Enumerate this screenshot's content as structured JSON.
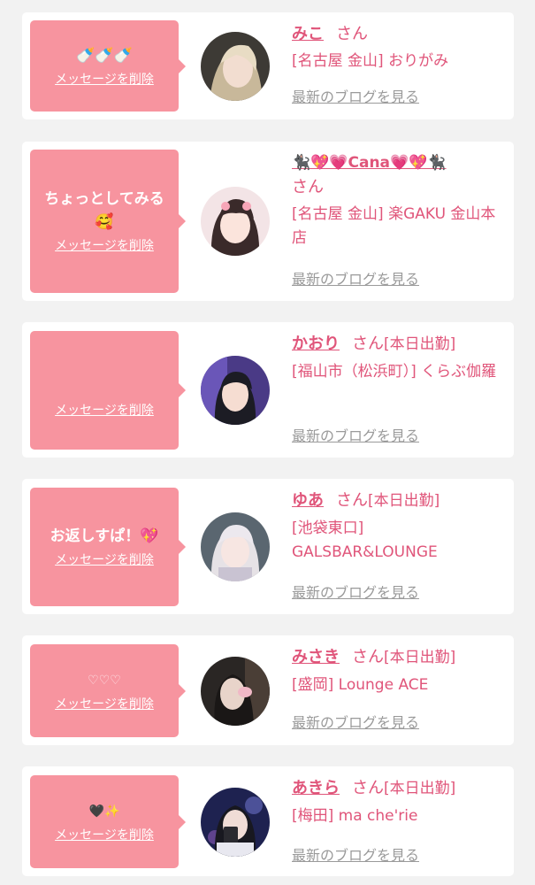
{
  "cards": [
    {
      "message": "🍼🍼🍼",
      "delete_label": "メッセージを削除",
      "name": "みこ",
      "san": "さん",
      "status": "",
      "shop": "[名古屋 金山] おりがみ",
      "blog_link": "最新のブログを見る"
    },
    {
      "message": "ちょっとしてみる🥰",
      "delete_label": "メッセージを削除",
      "name": "🐈‍⬛💖💗Cana💗💖🐈‍⬛",
      "san": "さん",
      "status": "",
      "shop": "[名古屋 金山] 楽GAKU 金山本店",
      "blog_link": "最新のブログを見る"
    },
    {
      "message": "",
      "delete_label": "メッセージを削除",
      "name": "かおり",
      "san": "さん",
      "status": "[本日出勤]",
      "shop": "[福山市（松浜町）] くらぶ伽羅",
      "blog_link": "最新のブログを見る"
    },
    {
      "message": "お返しすぱ！💖",
      "delete_label": "メッセージを削除",
      "name": "ゆあ",
      "san": "さん",
      "status": "[本日出勤]",
      "shop": "[池袋東口] GALSBAR&LOUNGE",
      "blog_link": "最新のブログを見る"
    },
    {
      "message": "♡♡♡",
      "delete_label": "メッセージを削除",
      "name": "みさき",
      "san": "さん",
      "status": "[本日出勤]",
      "shop": "[盛岡] Lounge ACE",
      "blog_link": "最新のブログを見る"
    },
    {
      "message": "🖤✨",
      "delete_label": "メッセージを削除",
      "name": "あきら",
      "san": "さん",
      "status": "[本日出勤]",
      "shop": "[梅田] ma che'rie",
      "blog_link": "最新のブログを見る"
    }
  ],
  "colors": {
    "accent": "#e0557a",
    "bubble": "#f7949f",
    "link_gray": "#9a9a9a",
    "background": "#f2f2f2"
  }
}
